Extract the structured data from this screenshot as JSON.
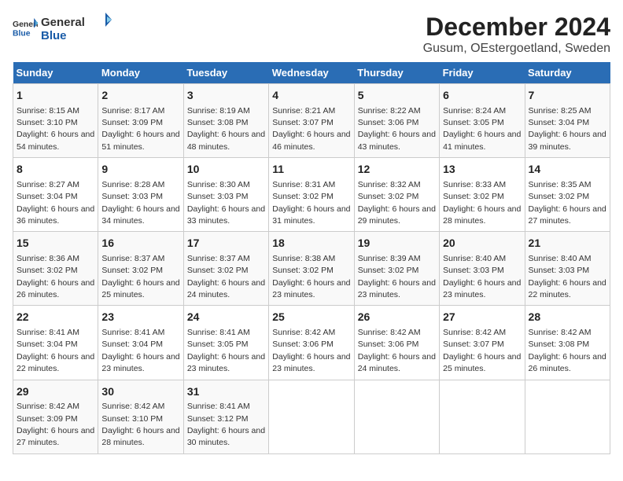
{
  "logo": {
    "general": "General",
    "blue": "Blue"
  },
  "title": "December 2024",
  "subtitle": "Gusum, OEstergoetland, Sweden",
  "header": {
    "accent_color": "#2a6db5"
  },
  "days_of_week": [
    "Sunday",
    "Monday",
    "Tuesday",
    "Wednesday",
    "Thursday",
    "Friday",
    "Saturday"
  ],
  "weeks": [
    [
      {
        "day": "1",
        "sunrise": "8:15 AM",
        "sunset": "3:10 PM",
        "daylight": "6 hours and 54 minutes."
      },
      {
        "day": "2",
        "sunrise": "8:17 AM",
        "sunset": "3:09 PM",
        "daylight": "6 hours and 51 minutes."
      },
      {
        "day": "3",
        "sunrise": "8:19 AM",
        "sunset": "3:08 PM",
        "daylight": "6 hours and 48 minutes."
      },
      {
        "day": "4",
        "sunrise": "8:21 AM",
        "sunset": "3:07 PM",
        "daylight": "6 hours and 46 minutes."
      },
      {
        "day": "5",
        "sunrise": "8:22 AM",
        "sunset": "3:06 PM",
        "daylight": "6 hours and 43 minutes."
      },
      {
        "day": "6",
        "sunrise": "8:24 AM",
        "sunset": "3:05 PM",
        "daylight": "6 hours and 41 minutes."
      },
      {
        "day": "7",
        "sunrise": "8:25 AM",
        "sunset": "3:04 PM",
        "daylight": "6 hours and 39 minutes."
      }
    ],
    [
      {
        "day": "8",
        "sunrise": "8:27 AM",
        "sunset": "3:04 PM",
        "daylight": "6 hours and 36 minutes."
      },
      {
        "day": "9",
        "sunrise": "8:28 AM",
        "sunset": "3:03 PM",
        "daylight": "6 hours and 34 minutes."
      },
      {
        "day": "10",
        "sunrise": "8:30 AM",
        "sunset": "3:03 PM",
        "daylight": "6 hours and 33 minutes."
      },
      {
        "day": "11",
        "sunrise": "8:31 AM",
        "sunset": "3:02 PM",
        "daylight": "6 hours and 31 minutes."
      },
      {
        "day": "12",
        "sunrise": "8:32 AM",
        "sunset": "3:02 PM",
        "daylight": "6 hours and 29 minutes."
      },
      {
        "day": "13",
        "sunrise": "8:33 AM",
        "sunset": "3:02 PM",
        "daylight": "6 hours and 28 minutes."
      },
      {
        "day": "14",
        "sunrise": "8:35 AM",
        "sunset": "3:02 PM",
        "daylight": "6 hours and 27 minutes."
      }
    ],
    [
      {
        "day": "15",
        "sunrise": "8:36 AM",
        "sunset": "3:02 PM",
        "daylight": "6 hours and 26 minutes."
      },
      {
        "day": "16",
        "sunrise": "8:37 AM",
        "sunset": "3:02 PM",
        "daylight": "6 hours and 25 minutes."
      },
      {
        "day": "17",
        "sunrise": "8:37 AM",
        "sunset": "3:02 PM",
        "daylight": "6 hours and 24 minutes."
      },
      {
        "day": "18",
        "sunrise": "8:38 AM",
        "sunset": "3:02 PM",
        "daylight": "6 hours and 23 minutes."
      },
      {
        "day": "19",
        "sunrise": "8:39 AM",
        "sunset": "3:02 PM",
        "daylight": "6 hours and 23 minutes."
      },
      {
        "day": "20",
        "sunrise": "8:40 AM",
        "sunset": "3:03 PM",
        "daylight": "6 hours and 23 minutes."
      },
      {
        "day": "21",
        "sunrise": "8:40 AM",
        "sunset": "3:03 PM",
        "daylight": "6 hours and 22 minutes."
      }
    ],
    [
      {
        "day": "22",
        "sunrise": "8:41 AM",
        "sunset": "3:04 PM",
        "daylight": "6 hours and 22 minutes."
      },
      {
        "day": "23",
        "sunrise": "8:41 AM",
        "sunset": "3:04 PM",
        "daylight": "6 hours and 23 minutes."
      },
      {
        "day": "24",
        "sunrise": "8:41 AM",
        "sunset": "3:05 PM",
        "daylight": "6 hours and 23 minutes."
      },
      {
        "day": "25",
        "sunrise": "8:42 AM",
        "sunset": "3:06 PM",
        "daylight": "6 hours and 23 minutes."
      },
      {
        "day": "26",
        "sunrise": "8:42 AM",
        "sunset": "3:06 PM",
        "daylight": "6 hours and 24 minutes."
      },
      {
        "day": "27",
        "sunrise": "8:42 AM",
        "sunset": "3:07 PM",
        "daylight": "6 hours and 25 minutes."
      },
      {
        "day": "28",
        "sunrise": "8:42 AM",
        "sunset": "3:08 PM",
        "daylight": "6 hours and 26 minutes."
      }
    ],
    [
      {
        "day": "29",
        "sunrise": "8:42 AM",
        "sunset": "3:09 PM",
        "daylight": "6 hours and 27 minutes."
      },
      {
        "day": "30",
        "sunrise": "8:42 AM",
        "sunset": "3:10 PM",
        "daylight": "6 hours and 28 minutes."
      },
      {
        "day": "31",
        "sunrise": "8:41 AM",
        "sunset": "3:12 PM",
        "daylight": "6 hours and 30 minutes."
      },
      null,
      null,
      null,
      null
    ]
  ]
}
